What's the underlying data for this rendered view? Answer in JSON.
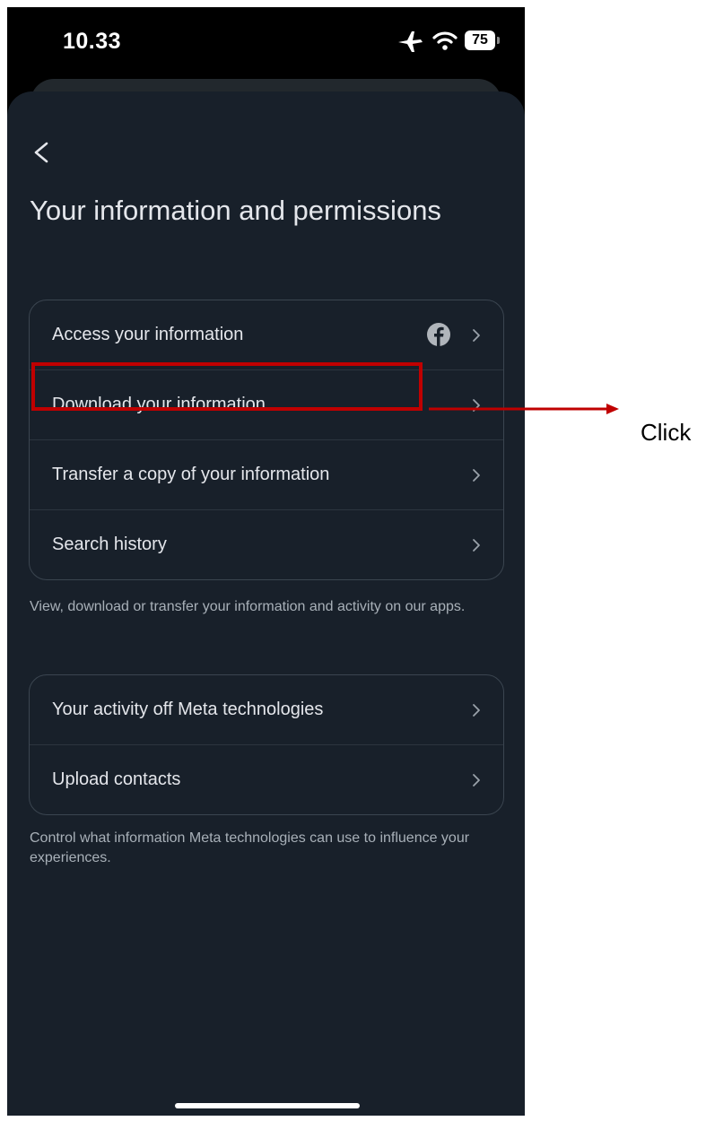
{
  "status_bar": {
    "time": "10.33",
    "battery": "75"
  },
  "screen": {
    "title": "Your information and permissions",
    "group1": {
      "items": [
        {
          "label": "Access your information",
          "icon": "facebook-icon"
        },
        {
          "label": "Download your information"
        },
        {
          "label": "Transfer a copy of your information"
        },
        {
          "label": "Search history"
        }
      ],
      "caption": "View, download or transfer your information and activity on our apps."
    },
    "group2": {
      "items": [
        {
          "label": "Your activity off Meta technologies"
        },
        {
          "label": "Upload contacts"
        }
      ],
      "caption": "Control what information Meta technologies can use to influence your experiences."
    }
  },
  "annotation": {
    "label": "Click",
    "color": "#c00000"
  },
  "colors": {
    "background": "#18202a",
    "text": "#e4e6eb",
    "secondary_text": "#a8b0b8",
    "border": "#3b4550"
  }
}
